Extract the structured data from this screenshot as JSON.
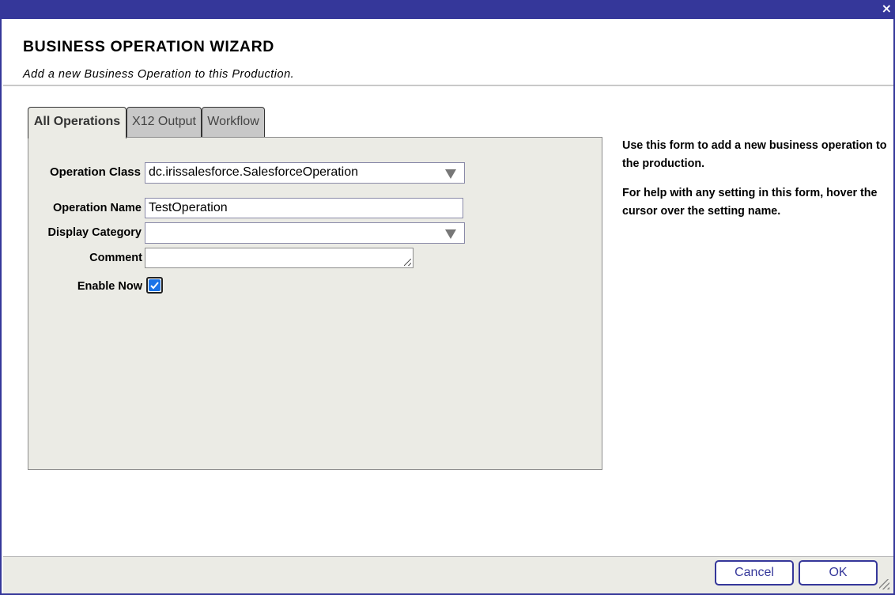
{
  "dialog": {
    "title": "BUSINESS OPERATION WIZARD",
    "subtitle": "Add a new Business Operation to this Production.",
    "close_icon": "×"
  },
  "tabs": [
    {
      "label": "All Operations",
      "active": true
    },
    {
      "label": "X12 Output",
      "active": false
    },
    {
      "label": "Workflow",
      "active": false
    }
  ],
  "form": {
    "operation_class": {
      "label": "Operation Class",
      "value": "dc.irissalesforce.SalesforceOperation"
    },
    "operation_name": {
      "label": "Operation Name",
      "value": "TestOperation"
    },
    "display_category": {
      "label": "Display Category",
      "value": ""
    },
    "comment": {
      "label": "Comment",
      "value": ""
    },
    "enable_now": {
      "label": "Enable Now",
      "checked": true
    }
  },
  "help": {
    "line1": "Use this form to add a new business operation to the production.",
    "line2": "For help with any setting in this form, hover the cursor over the setting name."
  },
  "buttons": {
    "cancel": "Cancel",
    "ok": "OK"
  },
  "colors": {
    "accent": "#35379a",
    "panel_bg": "#ebebe5",
    "checkbox": "#1a73e8"
  }
}
